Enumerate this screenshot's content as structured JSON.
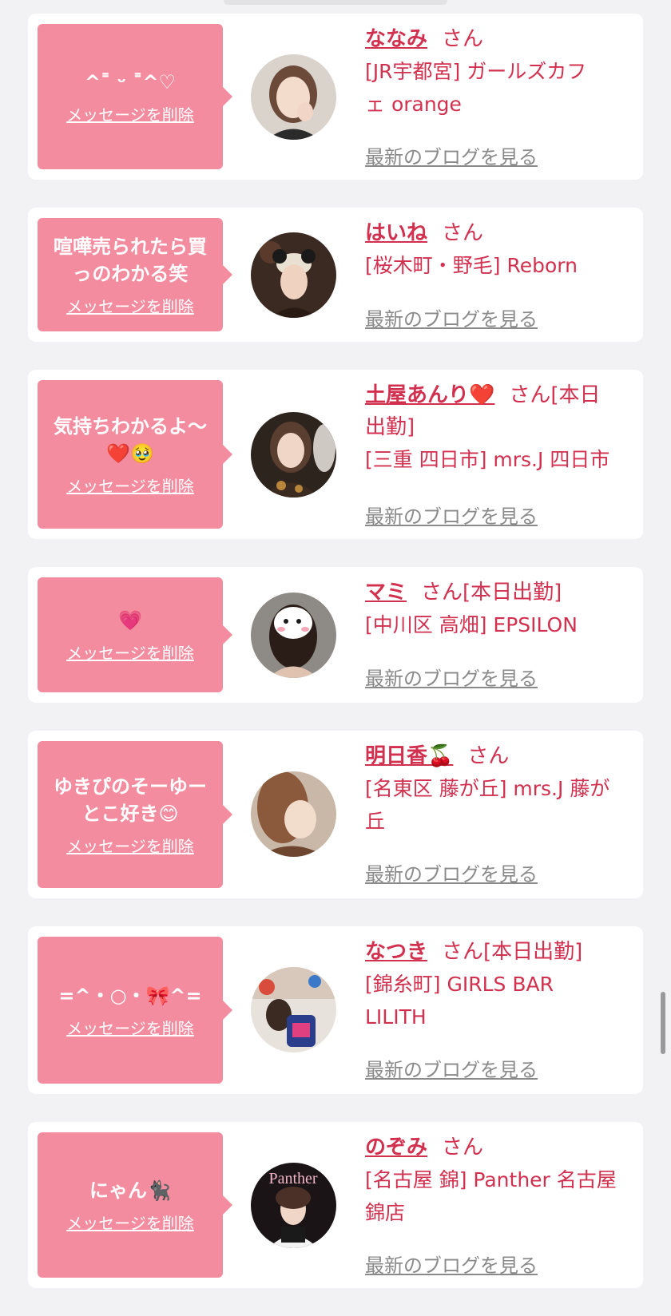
{
  "cards": [
    {
      "message_lines": [
        "^˭ ᵕ ˭^♡"
      ],
      "delete_label": "メッセージを削除",
      "name": "ななみ",
      "honorific": "さん",
      "status": "",
      "shop_lines": [
        "[JR宇都宮] ガールズカフ",
        "ェ orange"
      ],
      "blog_label": "最新のブログを見る"
    },
    {
      "message_lines": [
        "喧嘩売られたら買",
        "っのわかる笑"
      ],
      "delete_label": "メッセージを削除",
      "name": "はいね",
      "honorific": "さん",
      "status": "",
      "shop_lines": [
        "[桜木町・野毛] Reborn"
      ],
      "blog_label": "最新のブログを見る"
    },
    {
      "message_lines": [
        "気持ちわかるよ〜",
        "❤️🥹"
      ],
      "delete_label": "メッセージを削除",
      "name": "土屋あんり❤️",
      "honorific": "さん",
      "status": "[本日",
      "status_cont": "出勤]",
      "shop_lines": [
        "[三重 四日市] mrs.J 四日市"
      ],
      "blog_label": "最新のブログを見る"
    },
    {
      "message_lines": [
        "💗"
      ],
      "delete_label": "メッセージを削除",
      "name": "マミ",
      "honorific": "さん",
      "status": "[本日出勤]",
      "shop_lines": [
        "[中川区 高畑] EPSILON"
      ],
      "blog_label": "最新のブログを見る"
    },
    {
      "message_lines": [
        "ゆきぴのそーゆー",
        "とこ好き😊"
      ],
      "delete_label": "メッセージを削除",
      "name": "明日香🍒",
      "honorific": "さん",
      "status": "",
      "shop_lines": [
        "[名東区 藤が丘] mrs.J 藤が",
        "丘"
      ],
      "blog_label": "最新のブログを見る"
    },
    {
      "message_lines": [
        "=^・○・🎀^="
      ],
      "delete_label": "メッセージを削除",
      "name": "なつき",
      "honorific": "さん",
      "status": "[本日出勤]",
      "shop_lines": [
        "[錦糸町] GIRLS BAR",
        "LILITH"
      ],
      "blog_label": "最新のブログを見る"
    },
    {
      "message_lines": [
        "にゃん🐈‍⬛"
      ],
      "delete_label": "メッセージを削除",
      "name": "のぞみ",
      "honorific": "さん",
      "status": "",
      "shop_lines": [
        "[名古屋 錦] Panther 名古屋",
        "錦店"
      ],
      "blog_label": "最新のブログを見る",
      "avatar_text": "Panther"
    }
  ]
}
